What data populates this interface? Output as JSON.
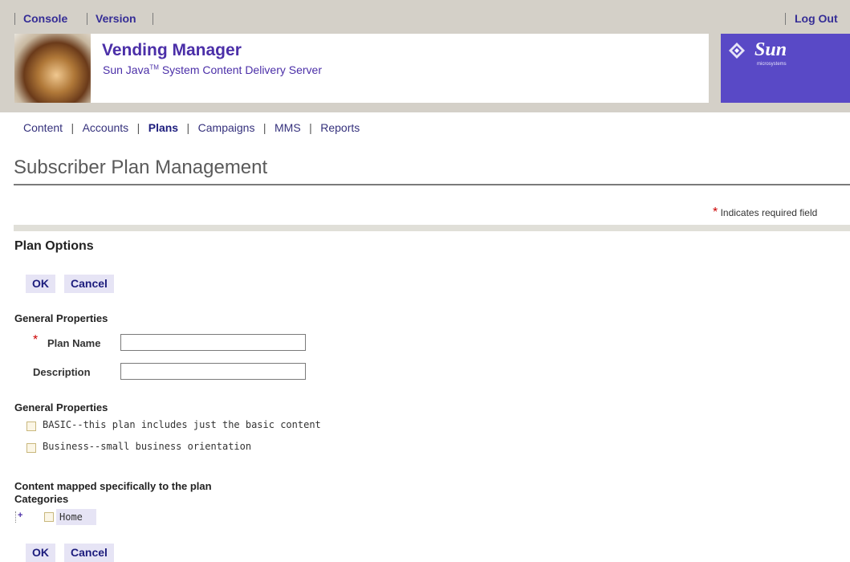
{
  "topnav": {
    "console": "Console",
    "version": "Version",
    "logout": "Log Out"
  },
  "banner": {
    "title": "Vending Manager",
    "subtitle_prefix": "Sun Java",
    "subtitle_tm": "TM",
    "subtitle_suffix": " System Content Delivery Server",
    "logo_text": "Sun",
    "logo_sub": "microsystems"
  },
  "nav": {
    "items": [
      "Content",
      "Accounts",
      "Plans",
      "Campaigns",
      "MMS",
      "Reports"
    ],
    "active": "Plans",
    "separator": "|"
  },
  "page": {
    "title": "Subscriber Plan Management",
    "required_note": "Indicates required field",
    "required_mark": "*",
    "section_title": "Plan Options"
  },
  "buttons": {
    "ok": "OK",
    "cancel": "Cancel"
  },
  "general1": {
    "heading": "General Properties",
    "plan_name_label": "Plan Name",
    "plan_name_value": "",
    "description_label": "Description",
    "description_value": ""
  },
  "general2": {
    "heading": "General Properties",
    "options": [
      {
        "label": "BASIC--this plan includes just the basic content",
        "checked": false
      },
      {
        "label": "Business--small business orientation",
        "checked": false
      }
    ]
  },
  "content": {
    "heading": "Content mapped specifically to the plan",
    "categories_label": "Categories",
    "tree_root": "Home",
    "expand_glyph": "+"
  },
  "colors": {
    "accent": "#4b2fa8",
    "sun_purple": "#5949c6",
    "button_bg": "#e6e4f5",
    "required": "#cc0000"
  }
}
